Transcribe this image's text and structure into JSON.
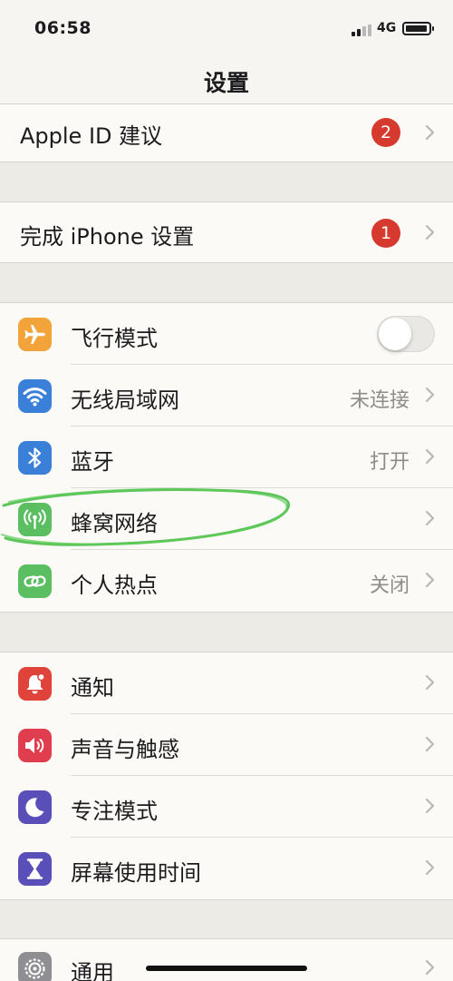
{
  "status_bar": {
    "time": "06:58",
    "network": "4G"
  },
  "nav": {
    "title": "设置"
  },
  "groups": {
    "apple_id": {
      "label": "Apple ID 建议",
      "badge": "2"
    },
    "setup": {
      "label": "完成 iPhone 设置",
      "badge": "1"
    },
    "connectivity": [
      {
        "label": "飞行模式",
        "icon": "airplane-icon",
        "color": "#f2a33a",
        "toggle_on": false
      },
      {
        "label": "无线局域网",
        "value": "未连接",
        "icon": "wifi-icon",
        "color": "#3a80d9"
      },
      {
        "label": "蓝牙",
        "value": "打开",
        "icon": "bluetooth-icon",
        "color": "#3a80d9"
      },
      {
        "label": "蜂窝网络",
        "icon": "cellular-antenna-icon",
        "color": "#5bbf62"
      },
      {
        "label": "个人热点",
        "value": "关闭",
        "icon": "hotspot-link-icon",
        "color": "#5bbf62"
      }
    ],
    "notifications": [
      {
        "label": "通知",
        "icon": "notification-bell-icon",
        "color": "#e0433a"
      },
      {
        "label": "声音与触感",
        "icon": "speaker-icon",
        "color": "#e03e4e"
      },
      {
        "label": "专注模式",
        "icon": "moon-icon",
        "color": "#5a4fb8"
      },
      {
        "label": "屏幕使用时间",
        "icon": "hourglass-icon",
        "color": "#5a4fb8"
      }
    ],
    "general": [
      {
        "label": "通用",
        "icon": "gear-icon",
        "color": "#8e8e93"
      }
    ]
  }
}
